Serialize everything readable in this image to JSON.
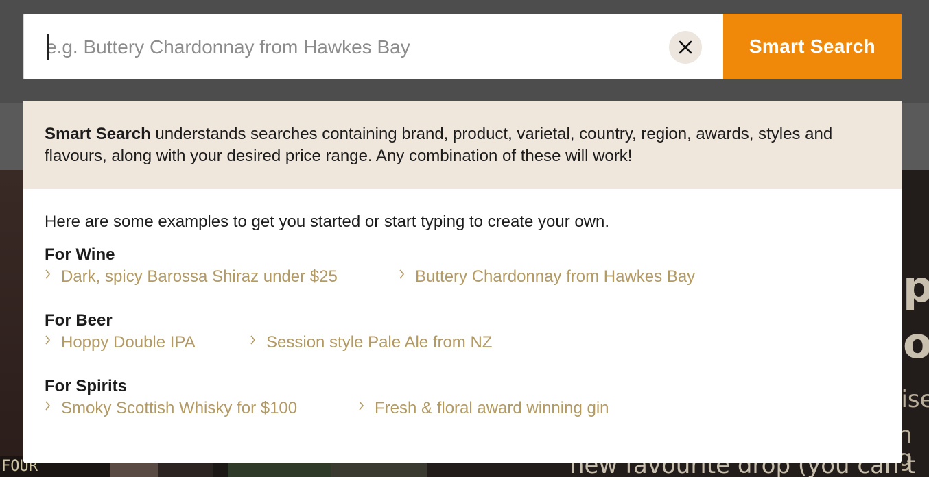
{
  "search": {
    "placeholder": "e.g. Buttery Chardonnay from Hawkes Bay",
    "value": "",
    "button_label": "Smart Search"
  },
  "info": {
    "bold_label": "Smart Search",
    "text": " understands searches containing brand, product, varietal, country, region, awards, styles and flavours, along with your desired price range. Any combination of these will work!"
  },
  "examples": {
    "intro": "Here are some examples to get you started or start typing to create your own.",
    "groups": [
      {
        "title": "For Wine",
        "items": [
          "Dark, spicy Barossa Shiraz under $25",
          "Buttery Chardonnay from Hawkes Bay"
        ]
      },
      {
        "title": "For Beer",
        "items": [
          "Hoppy Double IPA",
          "Session style Pale Ale from NZ"
        ]
      },
      {
        "title": "For Spirits",
        "items": [
          "Smoky Scottish Whisky for $100",
          "Fresh & floral award winning gin"
        ]
      }
    ]
  },
  "background": {
    "bottle_label": "FOUR PILLARS",
    "hero_right_big": [
      "p",
      "o"
    ],
    "hero_right_mid": [
      "lise",
      "n g",
      "n t"
    ],
    "hero_bottom": "new favourite drop (you can t"
  },
  "colors": {
    "accent": "#f0890a",
    "link": "#b39a63",
    "info_bg": "#efe6dc",
    "overlay_top": "#4d4d4d"
  },
  "icons": {
    "clear": "close-icon",
    "link": "chevron-right-icon"
  }
}
